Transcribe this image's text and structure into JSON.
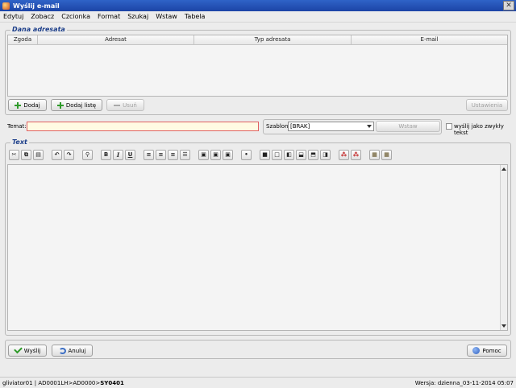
{
  "window": {
    "title": "Wyślij e-mail",
    "close_glyph": "✕"
  },
  "menu": [
    "Edytuj",
    "Zobacz",
    "Czcionka",
    "Format",
    "Szukaj",
    "Wstaw",
    "Tabela"
  ],
  "recipients": {
    "group_title": "Dana adresata",
    "columns": [
      "Zgoda",
      "Adresat",
      "Typ adresata",
      "E-mail"
    ],
    "buttons": {
      "add": "Dodaj",
      "add_list": "Dodaj listę",
      "remove": "Usuń",
      "settings": "Ustawienia"
    }
  },
  "subject": {
    "label": "Temat:",
    "value": ""
  },
  "template": {
    "label": "Szablon:",
    "selected": "[BRAK]",
    "insert_button": "Wstaw"
  },
  "plain_text": {
    "label": "wyślij jako zwykły tekst",
    "checked": false
  },
  "editor": {
    "group_title": "Text",
    "toolbar": {
      "bold": "B",
      "italic": "I",
      "underline": "U"
    },
    "content": ""
  },
  "actions": {
    "send": "Wyślij",
    "cancel": "Anuluj",
    "help": "Pomoc"
  },
  "status": {
    "path_prefix": "gliviator01 | AD0001LH>AD0000>",
    "path_current": "SY0401",
    "version": "Wersja: dzienna_03-11-2014 05:07"
  },
  "colors": {
    "title_bar": "#1c44a6",
    "group_title": "#1d3f8a",
    "subject_border": "#e06060",
    "subject_bg": "#fffbe3"
  }
}
